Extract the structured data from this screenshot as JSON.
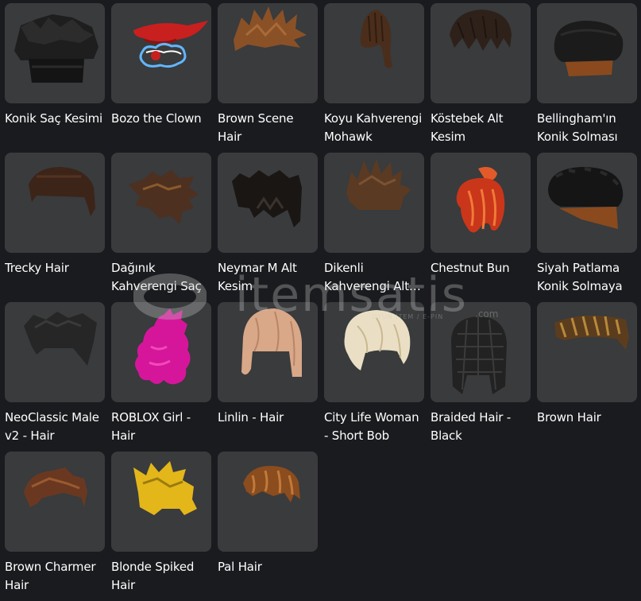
{
  "items": [
    {
      "name": "Konik Saç Kesimi",
      "icon": "hair-black-cone-icon",
      "color": "#222222"
    },
    {
      "name": "Bozo the Clown",
      "icon": "hair-clown-icon",
      "color": "#c8201f"
    },
    {
      "name": "Brown Scene Hair",
      "icon": "hair-scene-brown-icon",
      "color": "#8a5126"
    },
    {
      "name": "Koyu Kahverengi Mohawk",
      "icon": "hair-mohawk-icon",
      "color": "#4a2e1b"
    },
    {
      "name": "Köstebek Alt Kesim",
      "icon": "hair-undercut-icon",
      "color": "#2e211a"
    },
    {
      "name": "Bellingham'ın Konik Solması",
      "icon": "hair-fade-icon",
      "color": "#1b1b1b"
    },
    {
      "name": "Trecky Hair",
      "icon": "hair-trecky-icon",
      "color": "#3c2418"
    },
    {
      "name": "Dağınık Kahverengi Saç",
      "icon": "hair-messy-brown-icon",
      "color": "#4d3020"
    },
    {
      "name": "Neymar M Alt Kesim",
      "icon": "hair-neymar-icon",
      "color": "#1a1614"
    },
    {
      "name": "Dikenli Kahverengi Alt Kesim",
      "icon": "hair-spiky-brown-icon",
      "color": "#5a3a22"
    },
    {
      "name": "Chestnut Bun",
      "icon": "hair-bun-icon",
      "color": "#c9361a"
    },
    {
      "name": "Siyah Patlama Konik Solmaya",
      "icon": "hair-afro-fade-icon",
      "color": "#151515"
    },
    {
      "name": "NeoClassic Male v2 - Hair",
      "icon": "hair-neoclassic-icon",
      "color": "#262626"
    },
    {
      "name": "ROBLOX Girl - Hair",
      "icon": "hair-pink-icon",
      "color": "#d6169a"
    },
    {
      "name": "Linlin - Hair",
      "icon": "hair-linlin-icon",
      "color": "#d9a888"
    },
    {
      "name": "City Life Woman - Short Bob",
      "icon": "hair-blonde-bob-icon",
      "color": "#eadfc4"
    },
    {
      "name": "Braided Hair - Black",
      "icon": "hair-braided-icon",
      "color": "#222222"
    },
    {
      "name": "Brown Hair",
      "icon": "hair-brown-icon",
      "color": "#5b3d1e"
    },
    {
      "name": "Brown Charmer Hair",
      "icon": "hair-charmer-icon",
      "color": "#6a3820"
    },
    {
      "name": "Blonde Spiked Hair",
      "icon": "hair-blonde-spiked-icon",
      "color": "#e3b61a"
    },
    {
      "name": "Pal Hair",
      "icon": "hair-pal-icon",
      "color": "#8b4c1e"
    }
  ],
  "watermark": {
    "brand": "itemsatis",
    "sub": "OYUN İTEM / E-PIN",
    "domain": ".com"
  }
}
